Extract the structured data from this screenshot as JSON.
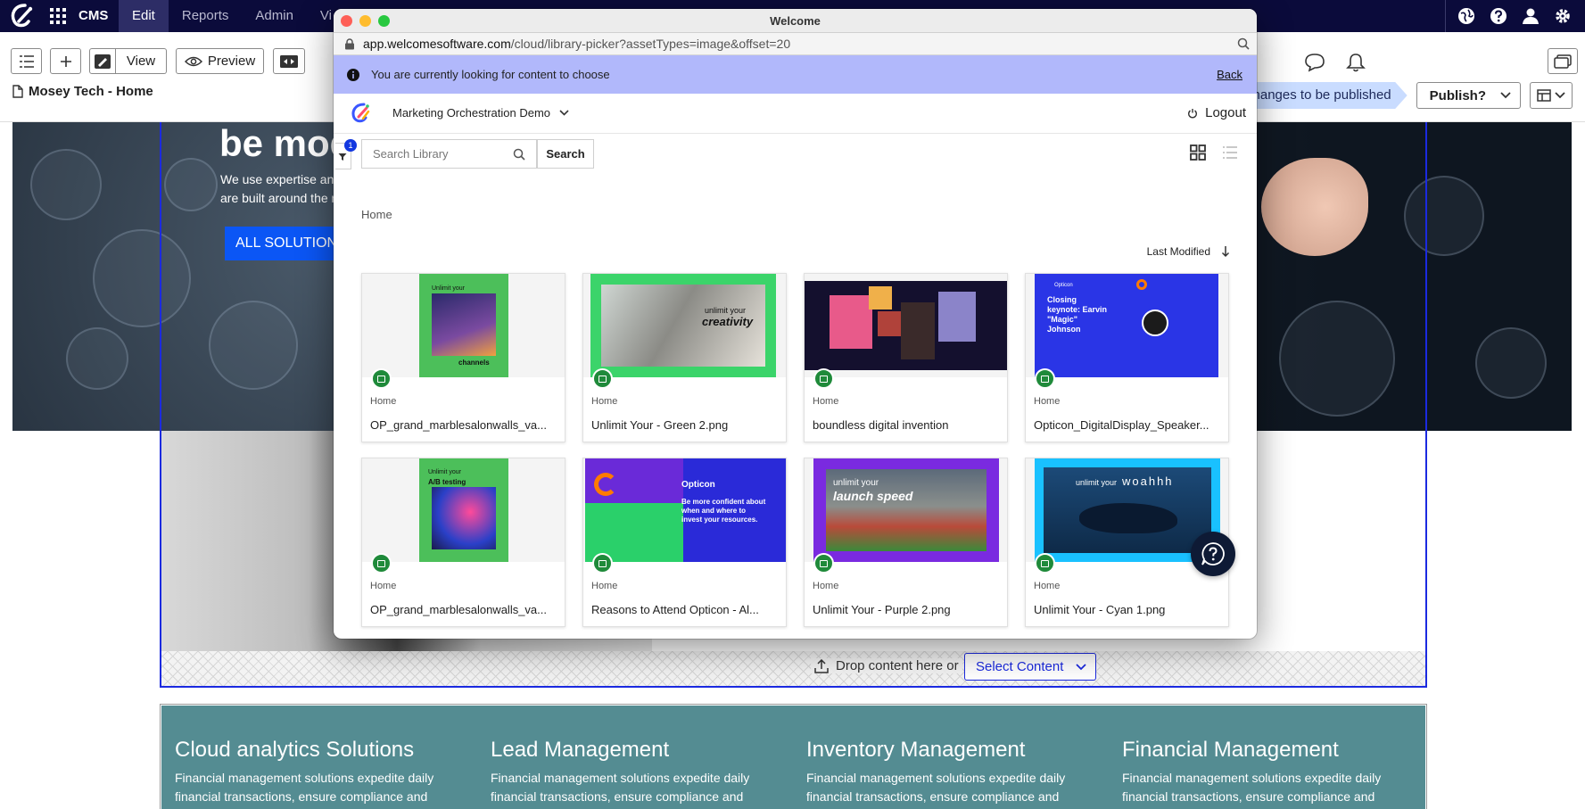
{
  "topbar": {
    "app_name": "CMS",
    "nav": [
      {
        "label": "Edit",
        "active": true
      },
      {
        "label": "Reports",
        "active": false
      },
      {
        "label": "Admin",
        "active": false
      },
      {
        "label": "Vi",
        "active": false
      }
    ],
    "icons": [
      "globe-icon",
      "help-icon",
      "user-icon",
      "gear-icon"
    ]
  },
  "toolbar": {
    "view_label": "View",
    "preview_label": "Preview",
    "page_title": "Mosey Tech - Home",
    "changes_label": "Changes to be published",
    "publish_label": "Publish?"
  },
  "hero": {
    "title": "be mode",
    "subtitle_line1": "We use expertise and t",
    "subtitle_line2": "are built around the ne",
    "button": "ALL SOLUTIONS"
  },
  "dropzone": {
    "label": "Drop content here or",
    "select_label": "Select Content"
  },
  "features": [
    {
      "title": "Cloud analytics Solutions",
      "text": "Financial management solutions expedite daily financial transactions, ensure compliance and"
    },
    {
      "title": "Lead Management",
      "text": "Financial management solutions expedite daily financial transactions, ensure compliance and"
    },
    {
      "title": "Inventory Management",
      "text": "Financial management solutions expedite daily financial transactions, ensure compliance and"
    },
    {
      "title": "Financial Management",
      "text": "Financial management solutions expedite daily financial transactions, ensure compliance and"
    }
  ],
  "popup": {
    "window_title": "Welcome",
    "url_host": "app.welcomesoftware.com",
    "url_path": "/cloud/library-picker?assetTypes=image&offset=20",
    "info_text": "You are currently looking for content to choose",
    "back_label": "Back",
    "org_name": "Marketing Orchestration Demo",
    "logout_label": "Logout",
    "filter_count": "1",
    "search_placeholder": "Search Library",
    "search_button": "Search",
    "breadcrumb": "Home",
    "sort_label": "Last Modified",
    "cards": [
      {
        "location": "Home",
        "name": "OP_grand_marblesalonwalls_va...",
        "thumb_text": "Unlimit your",
        "thumb_text2": "channels"
      },
      {
        "location": "Home",
        "name": "Unlimit Your - Green 2.png",
        "thumb_text": "unlimit your",
        "thumb_text2": "creativity"
      },
      {
        "location": "Home",
        "name": "boundless digital invention",
        "thumb_text": "",
        "thumb_text2": ""
      },
      {
        "location": "Home",
        "name": "Opticon_DigitalDisplay_Speaker...",
        "thumb_text": "Closing keynote: Earvin \"Magic\" Johnson",
        "thumb_text2": "Opticon"
      },
      {
        "location": "Home",
        "name": "OP_grand_marblesalonwalls_va...",
        "thumb_text": "Unlimit your",
        "thumb_text2": "A/B testing"
      },
      {
        "location": "Home",
        "name": "Reasons to Attend Opticon - Al...",
        "thumb_text": "Be more confident about when and where to invest your resources.",
        "thumb_text2": "Opticon"
      },
      {
        "location": "Home",
        "name": "Unlimit Your - Purple 2.png",
        "thumb_text": "unlimit your",
        "thumb_text2": "launch speed"
      },
      {
        "location": "Home",
        "name": "Unlimit Your - Cyan 1.png",
        "thumb_text": "unlimit your",
        "thumb_text2": "woahhh"
      }
    ]
  },
  "colors": {
    "topbar_bg": "#0b0b3b",
    "accent_blue": "#1b2ae0",
    "info_bar": "#b1b8fb",
    "features_bg": "#548c92",
    "badge_green": "#1f8a3a"
  }
}
